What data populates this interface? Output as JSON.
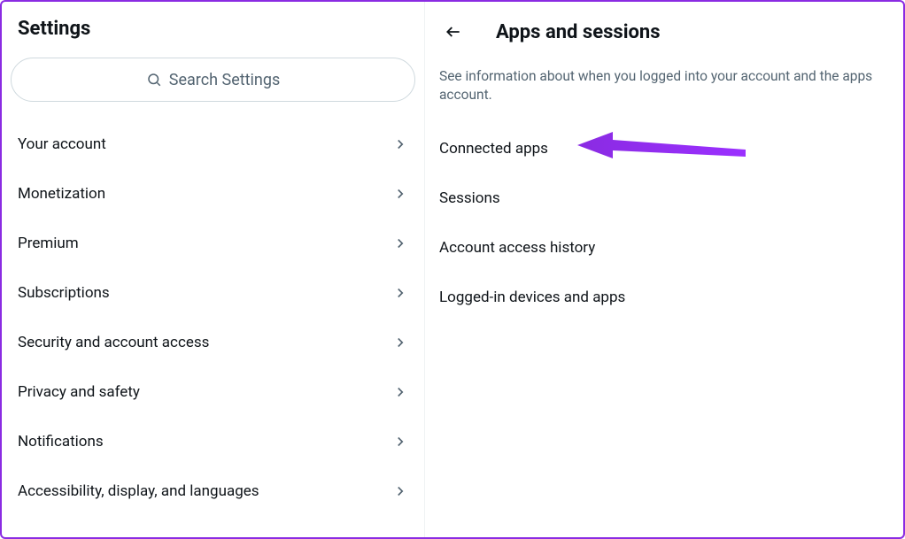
{
  "left": {
    "title": "Settings",
    "search_placeholder": "Search Settings",
    "items": [
      {
        "label": "Your account"
      },
      {
        "label": "Monetization"
      },
      {
        "label": "Premium"
      },
      {
        "label": "Subscriptions"
      },
      {
        "label": "Security and account access"
      },
      {
        "label": "Privacy and safety"
      },
      {
        "label": "Notifications"
      },
      {
        "label": "Accessibility, display, and languages"
      }
    ]
  },
  "right": {
    "title": "Apps and sessions",
    "description": "See information about when you logged into your account and the apps account.",
    "items": [
      {
        "label": "Connected apps"
      },
      {
        "label": "Sessions"
      },
      {
        "label": "Account access history"
      },
      {
        "label": "Logged-in devices and apps"
      }
    ]
  }
}
